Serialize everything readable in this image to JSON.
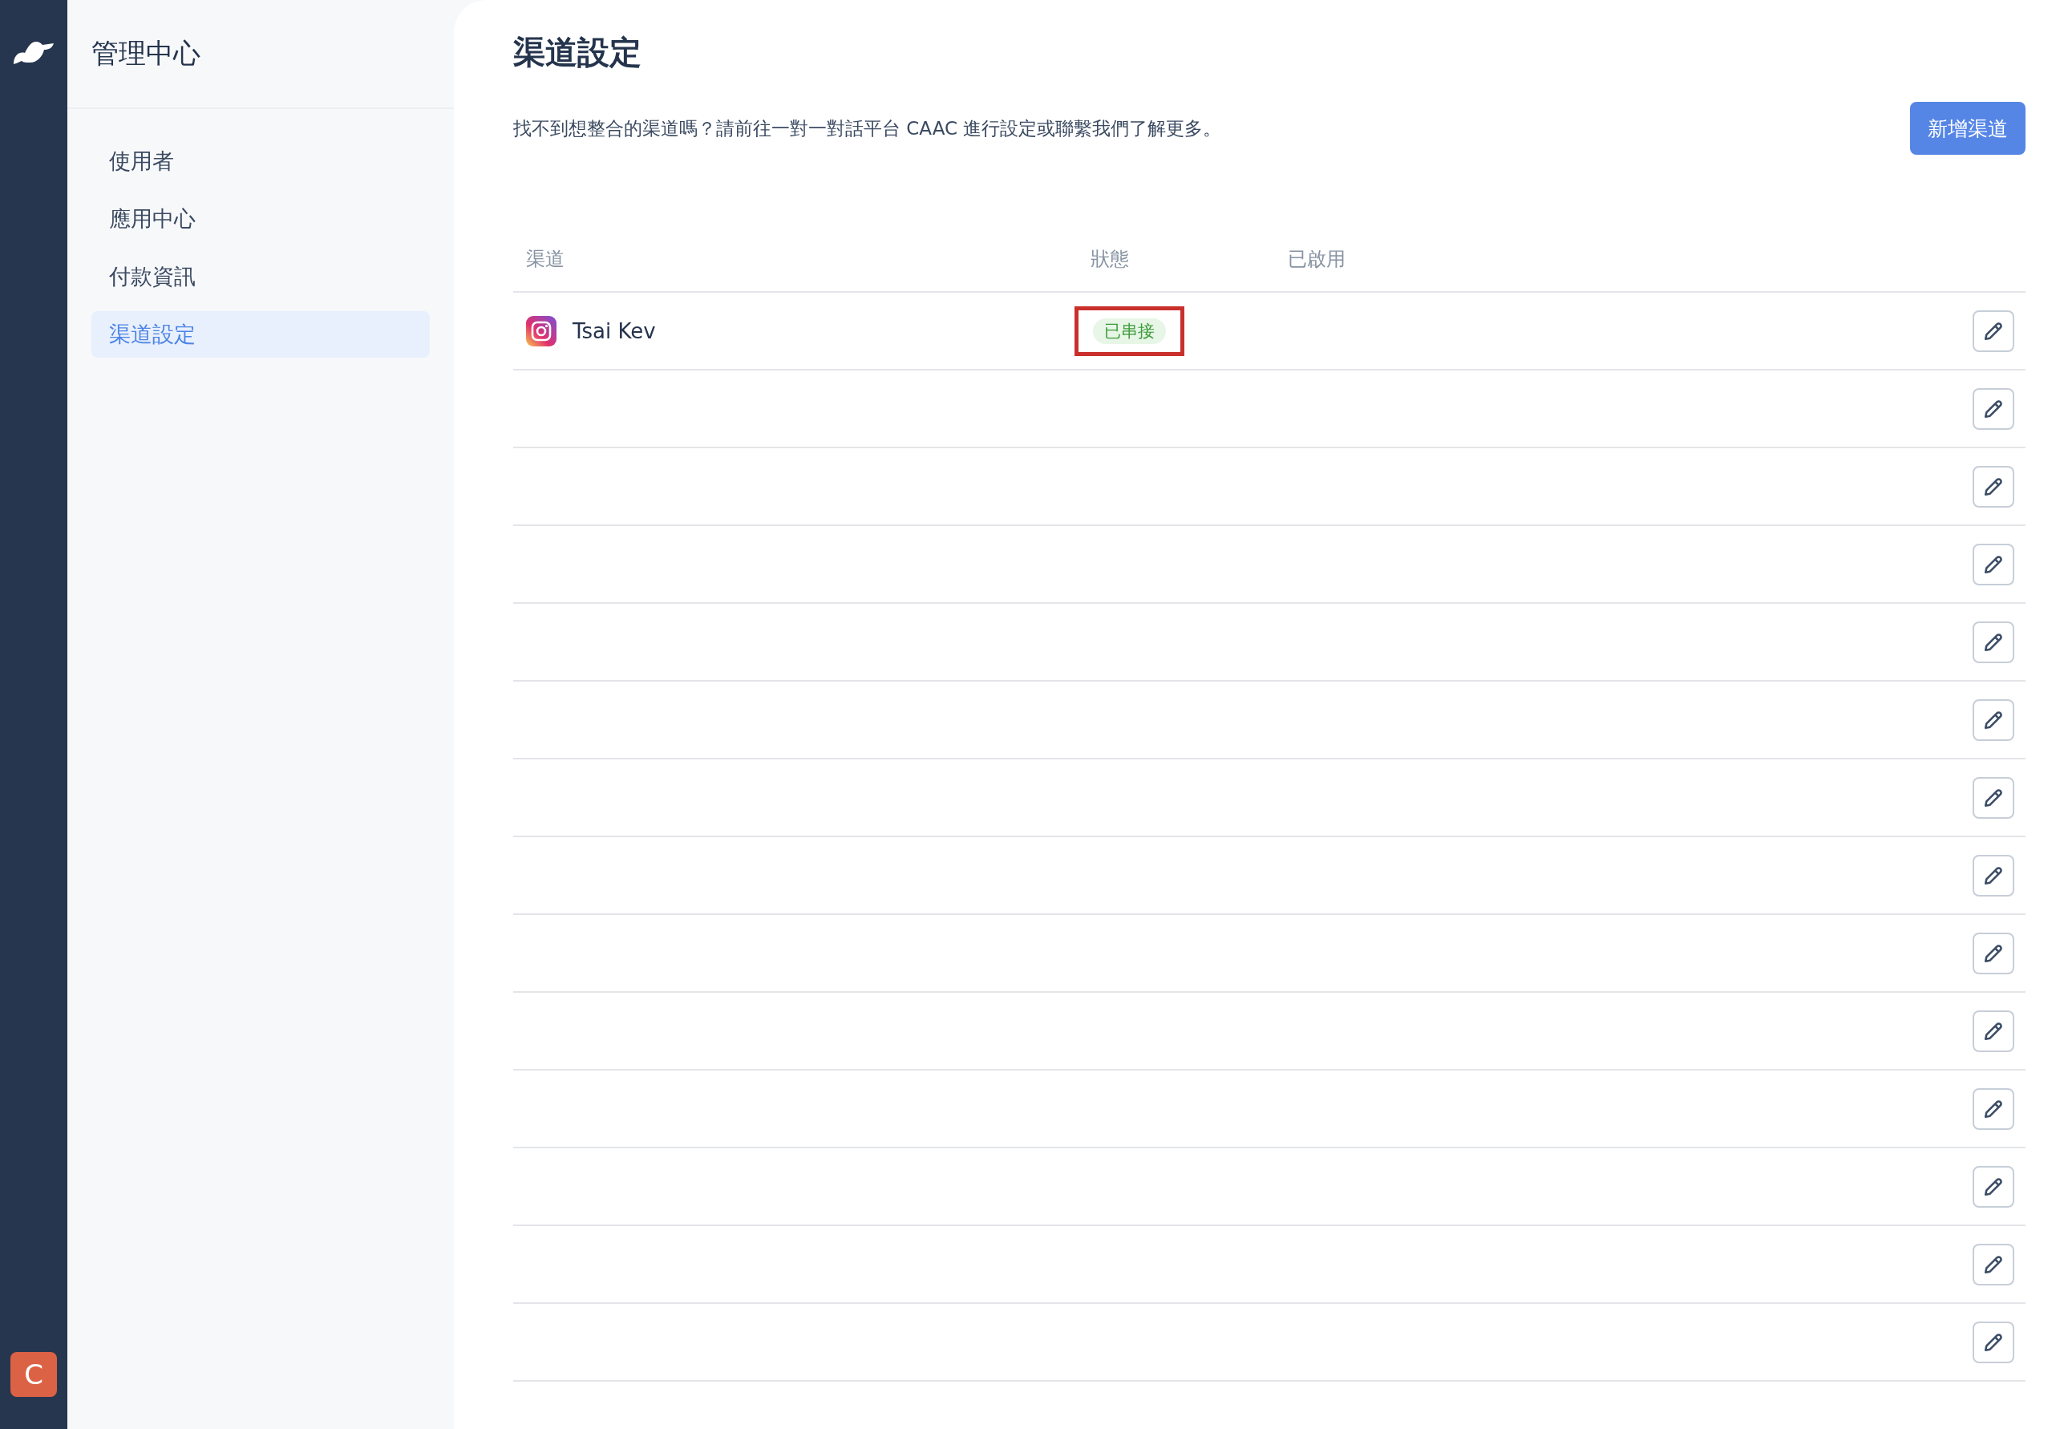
{
  "rail": {
    "avatar_letter": "C"
  },
  "sidebar": {
    "title": "管理中心",
    "items": [
      {
        "label": "使用者",
        "selected": false
      },
      {
        "label": "應用中心",
        "selected": false
      },
      {
        "label": "付款資訊",
        "selected": false
      },
      {
        "label": "渠道設定",
        "selected": true
      }
    ]
  },
  "main": {
    "title": "渠道設定",
    "description": "找不到想整合的渠道嗎？請前往一對一對話平台 CAAC 進行設定或聯繫我們了解更多。",
    "add_button": "新增渠道",
    "table": {
      "columns": [
        "渠道",
        "狀態",
        "已啟用"
      ],
      "rows": [
        {
          "kind": "channel",
          "name": "Tsai Kev",
          "status": "已串接",
          "highlighted": true
        },
        {
          "kind": "empty"
        },
        {
          "kind": "empty"
        },
        {
          "kind": "empty"
        },
        {
          "kind": "empty"
        },
        {
          "kind": "empty"
        },
        {
          "kind": "empty"
        },
        {
          "kind": "empty"
        },
        {
          "kind": "empty"
        },
        {
          "kind": "empty"
        },
        {
          "kind": "empty"
        },
        {
          "kind": "empty"
        },
        {
          "kind": "empty"
        },
        {
          "kind": "empty"
        }
      ]
    }
  }
}
